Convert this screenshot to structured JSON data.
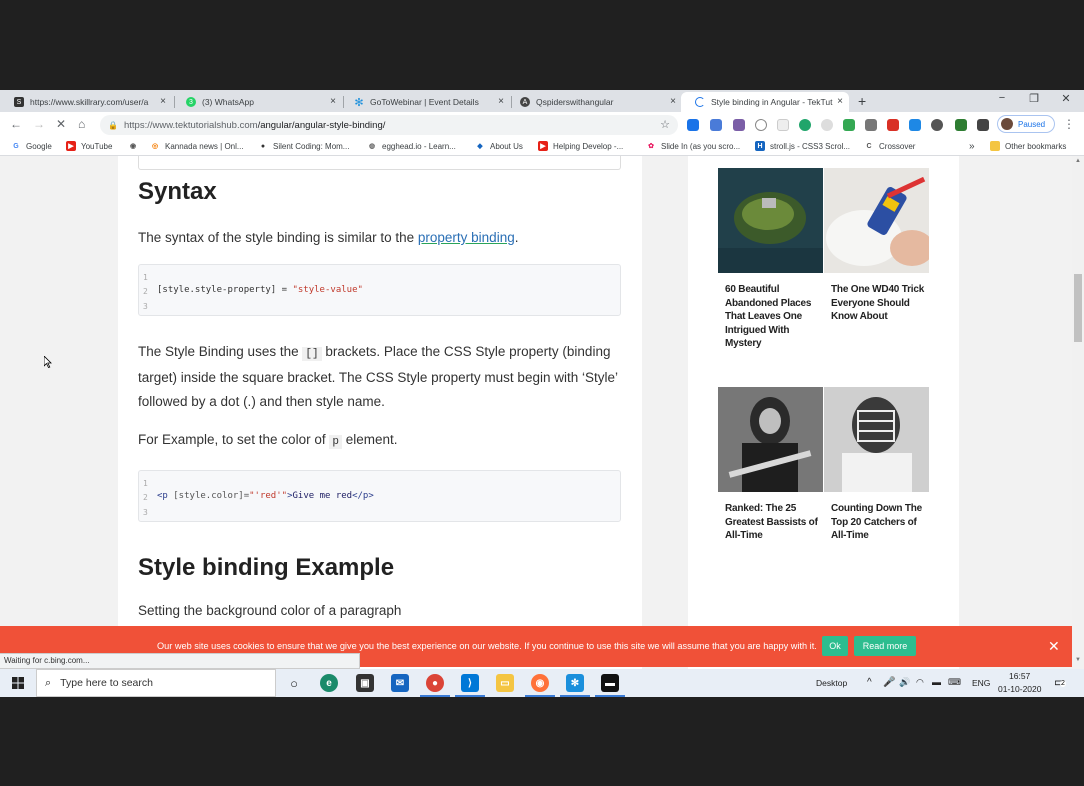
{
  "tabs": [
    {
      "label": "https://www.skillrary.com/user/a",
      "favicon_color": "#333333",
      "favicon_glyph": "S",
      "active": false
    },
    {
      "label": "(3) WhatsApp",
      "favicon_color": "#25d366",
      "favicon_glyph": "3",
      "active": false
    },
    {
      "label": "GoToWebinar | Event Details",
      "favicon_color": "#1a8fdc",
      "favicon_glyph": "✻",
      "active": false
    },
    {
      "label": "Qspiderswithangular",
      "favicon_color": "#444444",
      "favicon_glyph": "A",
      "active": false
    },
    {
      "label": "Style binding in Angular - TekTut",
      "favicon_color": "#1a73e8",
      "favicon_glyph": "C",
      "active": true
    }
  ],
  "tab_close_glyph": "×",
  "new_tab_glyph": "+",
  "window_controls": {
    "minimize": "−",
    "restore": "❐",
    "close": "✕"
  },
  "toolbar": {
    "back_glyph": "←",
    "forward_glyph": "→",
    "stop_glyph": "✕",
    "home_glyph": "⌂",
    "url_host": "https://www.tektutorialshub.com",
    "url_path": "/angular/angular-style-binding/",
    "star_glyph": "☆",
    "profile_label": "Paused",
    "menu_glyph": "⋮"
  },
  "bookmarks": [
    {
      "label": "Google",
      "color": "#4285f4",
      "glyph": "G"
    },
    {
      "label": "YouTube",
      "color": "#e62117",
      "glyph": "▶"
    },
    {
      "label": "",
      "color": "#555555",
      "glyph": "◉"
    },
    {
      "label": "Kannada news | Onl...",
      "color": "#f57c00",
      "glyph": "◎"
    },
    {
      "label": "Silent Coding: Mom...",
      "color": "#333333",
      "glyph": "●"
    },
    {
      "label": "egghead.io - Learn...",
      "color": "#666666",
      "glyph": "◍"
    },
    {
      "label": "About Us",
      "color": "#1565c0",
      "glyph": "◆"
    },
    {
      "label": "Helping Develop -...",
      "color": "#e62117",
      "glyph": "▶"
    },
    {
      "label": "Slide In (as you scro...",
      "color": "#e91e63",
      "glyph": "✿"
    },
    {
      "label": "stroll.js - CSS3 Scrol...",
      "color": "#1565c0",
      "glyph": "H"
    },
    {
      "label": "Crossover",
      "color": "#555555",
      "glyph": "C"
    }
  ],
  "bookmarks_overflow": "»",
  "other_bookmarks": "Other bookmarks",
  "article": {
    "heading_syntax": "Syntax",
    "syntax_intro_prefix": "The syntax of the style binding is similar to the ",
    "syntax_intro_link": "property binding",
    "syntax_intro_suffix": ".",
    "code1": {
      "lines": [
        "1",
        "2",
        "3"
      ],
      "code_plain": "[style.style-property] = ",
      "code_string": "\"style-value\""
    },
    "para2_a": "The Style Binding uses the ",
    "para2_code": "[]",
    "para2_b": " brackets. Place the CSS Style property (binding target) inside the square bracket. The CSS Style property must begin with ‘Style’ followed by a dot (.) and then style name.",
    "para3_a": "For Example, to set the color of ",
    "para3_code": "p",
    "para3_b": " element.",
    "code2": {
      "lines": [
        "1",
        "2",
        "3"
      ],
      "tag_open": "<p ",
      "attr": "[style.color]=",
      "string": "\"'red'\"",
      "gt": ">",
      "text": "Give me red",
      "tag_close": "</p>"
    },
    "heading_example": "Style binding Example",
    "para4": "Setting the background color of a paragraph"
  },
  "sidebar": {
    "cards": [
      {
        "caption": "60 Beautiful Abandoned Places That Leaves One Intrigued With Mystery"
      },
      {
        "caption": "The One WD40 Trick Everyone Should Know About"
      },
      {
        "caption": "Ranked: The 25 Greatest Bassists of All-Time"
      },
      {
        "caption": "Counting Down The Top 20 Catchers of All-Time"
      }
    ]
  },
  "cookie": {
    "text": "Our web site uses cookies to ensure that we give you the best experience on our website. If you continue to use this site we will assume that you are happy with it.",
    "ok": "Ok",
    "read_more": "Read more",
    "close": "✕"
  },
  "status_text": "Waiting for c.bing.com...",
  "taskbar": {
    "search_placeholder": "Type here to search",
    "desktop_label": "Desktop",
    "language": "ENG",
    "time": "16:57",
    "date": "01-10-2020",
    "notification_count": "2"
  }
}
